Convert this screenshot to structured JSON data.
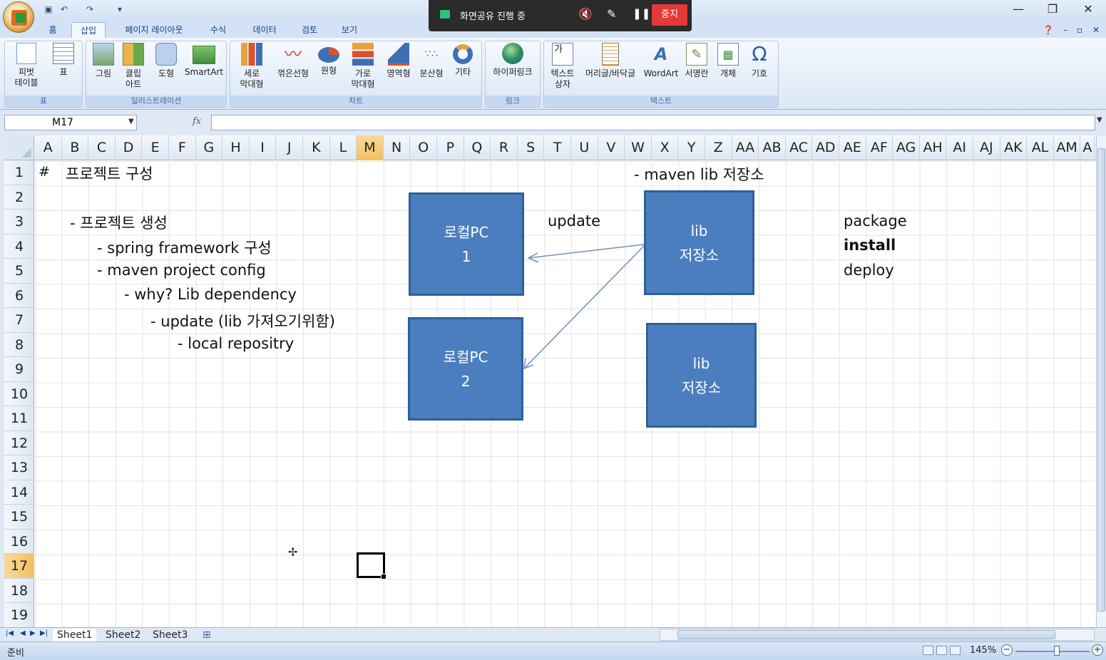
{
  "share": {
    "status": "화면공유 진행 중",
    "stop_label": "중지"
  },
  "tabs": [
    "홈",
    "삽입",
    "페이지 레이아웃",
    "수식",
    "데이터",
    "검토",
    "보기"
  ],
  "ribbon": {
    "groups": {
      "table": "표",
      "illustration": "일러스트레이션",
      "chart": "차트",
      "link": "링크",
      "text": "텍스트"
    },
    "pivot": [
      "피벗",
      "테이블"
    ],
    "table": "표",
    "picture": "그림",
    "clipart": [
      "클립",
      "아트"
    ],
    "shape": "도형",
    "smartart": "SmartArt",
    "column": [
      "세로",
      "막대형"
    ],
    "line": "꺾은선형",
    "pie": "원형",
    "bar": [
      "가로",
      "막대형"
    ],
    "area": "영역형",
    "scatter": "분산형",
    "other": "기타",
    "hyperlink": "하이퍼링크",
    "textbox": [
      "텍스트",
      "상자"
    ],
    "headerfooter": "머리글/바닥글",
    "wordart": "WordArt",
    "signature": "서명란",
    "object": "개체",
    "symbol": "기호"
  },
  "namebox": "M17",
  "columns": [
    "A",
    "B",
    "C",
    "D",
    "E",
    "F",
    "G",
    "H",
    "I",
    "J",
    "K",
    "L",
    "M",
    "N",
    "O",
    "P",
    "Q",
    "R",
    "S",
    "T",
    "U",
    "V",
    "W",
    "X",
    "Y",
    "Z",
    "AA",
    "AB",
    "AC",
    "AD",
    "AE",
    "AF",
    "AG",
    "AH",
    "AI",
    "AJ",
    "AK",
    "AL",
    "AM",
    "A"
  ],
  "rows": [
    "1",
    "2",
    "3",
    "4",
    "5",
    "6",
    "7",
    "8",
    "9",
    "10",
    "11",
    "12",
    "13",
    "14",
    "15",
    "16",
    "17",
    "18",
    "19"
  ],
  "cells": {
    "a1": "#",
    "b1": "프로젝트 구성",
    "b3": "- 프로젝트 생성",
    "c4": "- spring framework 구성",
    "c5": "- maven project config",
    "d6": "- why? Lib dependency",
    "e7": "- update (lib 가져오기위함)",
    "f8": "- local repositry",
    "w1": "- maven lib 저장소",
    "t3": "update",
    "ae3": "package",
    "ae4": "install",
    "ae5": "deploy"
  },
  "shapes": {
    "pc1": [
      "로컬PC",
      "1"
    ],
    "pc2": [
      "로컬PC",
      "2"
    ],
    "lib1": [
      "lib",
      "저장소"
    ],
    "lib2": [
      "lib",
      "저장소"
    ]
  },
  "colors": {
    "box_fill": "#4b7ebf",
    "box_border": "#2f5f98",
    "arrow": "#6f8fbf"
  },
  "sheet_tabs": [
    "Sheet1",
    "Sheet2",
    "Sheet3"
  ],
  "status": {
    "text": "준비",
    "zoom": "145%"
  }
}
